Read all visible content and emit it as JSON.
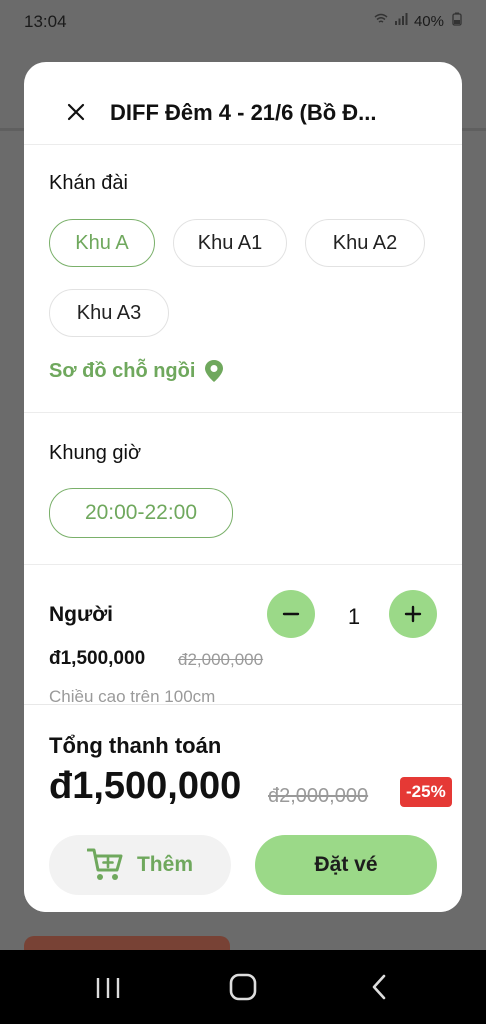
{
  "status_bar": {
    "time": "13:04",
    "battery": "40%"
  },
  "sheet": {
    "title": "DIFF Đêm 4 - 21/6 (Bồ Đ..."
  },
  "stand": {
    "label": "Khán đài",
    "options": [
      "Khu A",
      "Khu A1",
      "Khu A2",
      "Khu A3"
    ],
    "selected": "Khu A",
    "seat_map_link": "Sơ đồ chỗ ngồi"
  },
  "time_slot": {
    "label": "Khung giờ",
    "options": [
      "20:00-22:00"
    ],
    "selected": "20:00-22:00"
  },
  "ticket": {
    "type": "Người",
    "quantity": "1",
    "price": "đ1,500,000",
    "old_price": "đ2,000,000",
    "note": "Chiều cao trên 100cm"
  },
  "footer": {
    "total_label": "Tổng thanh toán",
    "total_price": "đ1,500,000",
    "total_old_price": "đ2,000,000",
    "discount": "-25%",
    "add_label": "Thêm",
    "book_label": "Đặt vé"
  },
  "colors": {
    "accent": "#6fa85d",
    "accent_light": "#9bd988",
    "discount": "#e53935"
  },
  "icons": [
    "close-icon",
    "location-pin-icon",
    "minus-icon",
    "plus-icon",
    "add-to-cart-icon",
    "nav-recents-icon",
    "nav-home-icon",
    "nav-back-icon"
  ]
}
